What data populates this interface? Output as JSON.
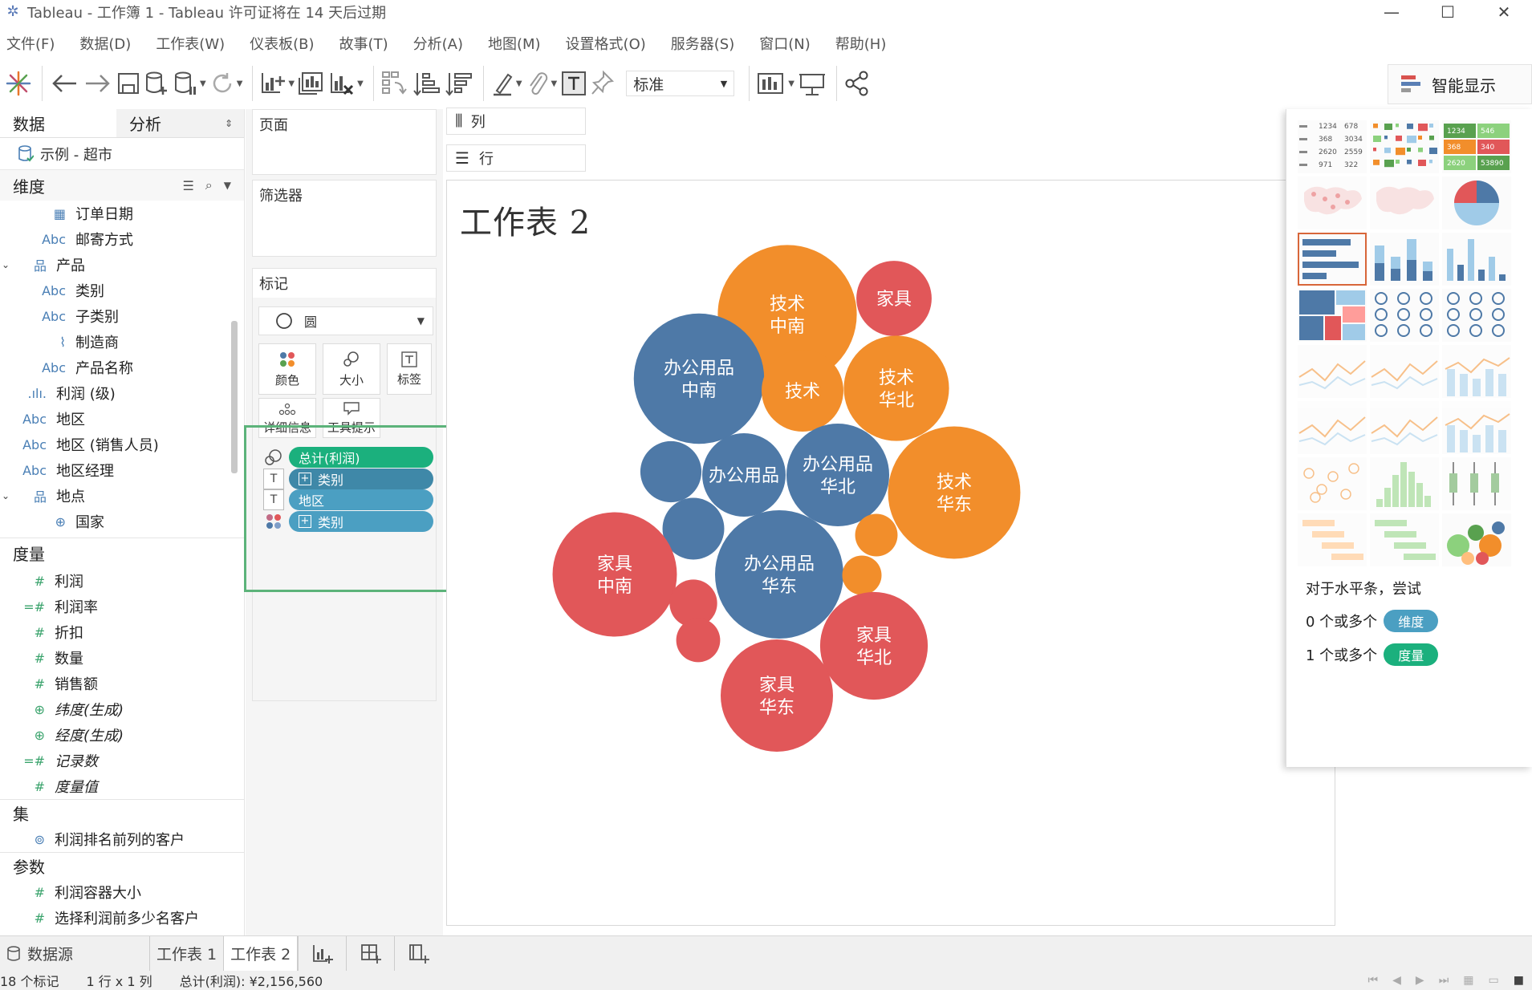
{
  "window": {
    "title": "Tableau - 工作簿 1 - Tableau 许可证将在 14 天后过期",
    "minimize": "—",
    "maximize": "☐",
    "close": "✕"
  },
  "menu": [
    "文件(F)",
    "数据(D)",
    "工作表(W)",
    "仪表板(B)",
    "故事(T)",
    "分析(A)",
    "地图(M)",
    "设置格式(O)",
    "服务器(S)",
    "窗口(N)",
    "帮助(H)"
  ],
  "toolbar": {
    "fit_select": "标准",
    "show_me_label": "智能显示"
  },
  "datapane": {
    "tab_data": "数据",
    "tab_analysis": "分析",
    "datasource": "示例 - 超市",
    "dimensions_label": "维度",
    "dimensions": [
      {
        "icon": "calendar-icon",
        "glyph": "▦",
        "label": "订单日期",
        "indent": 1,
        "caret": ""
      },
      {
        "icon": "abc-icon",
        "glyph": "Abc",
        "label": "邮寄方式",
        "indent": 1,
        "caret": ""
      },
      {
        "icon": "hierarchy-icon",
        "glyph": "品",
        "label": "产品",
        "indent": 0,
        "caret": "⌄"
      },
      {
        "icon": "abc-icon",
        "glyph": "Abc",
        "label": "类别",
        "indent": 1,
        "caret": ""
      },
      {
        "icon": "abc-icon",
        "glyph": "Abc",
        "label": "子类别",
        "indent": 1,
        "caret": ""
      },
      {
        "icon": "paperclip-icon",
        "glyph": "⌇",
        "label": "制造商",
        "indent": 1,
        "caret": ""
      },
      {
        "icon": "abc-icon",
        "glyph": "Abc",
        "label": "产品名称",
        "indent": 1,
        "caret": ""
      },
      {
        "icon": "bin-icon",
        "glyph": ".ılı.",
        "label": "利润 (级)",
        "indent": 0,
        "caret": ""
      },
      {
        "icon": "abc-icon",
        "glyph": "Abc",
        "label": "地区",
        "indent": 0,
        "caret": ""
      },
      {
        "icon": "abc-icon",
        "glyph": "Abc",
        "label": "地区 (销售人员)",
        "indent": 0,
        "caret": ""
      },
      {
        "icon": "abc-icon",
        "glyph": "Abc",
        "label": "地区经理",
        "indent": 0,
        "caret": ""
      },
      {
        "icon": "hierarchy-icon",
        "glyph": "品",
        "label": "地点",
        "indent": 0,
        "caret": "⌄"
      },
      {
        "icon": "globe-icon",
        "glyph": "⊕",
        "label": "国家",
        "indent": 1,
        "caret": ""
      }
    ],
    "measures_label": "度量",
    "measures": [
      {
        "glyph": "#",
        "label": "利润",
        "italic": false
      },
      {
        "glyph": "=#",
        "label": "利润率",
        "italic": false
      },
      {
        "glyph": "#",
        "label": "折扣",
        "italic": false
      },
      {
        "glyph": "#",
        "label": "数量",
        "italic": false
      },
      {
        "glyph": "#",
        "label": "销售额",
        "italic": false
      },
      {
        "glyph": "⊕",
        "label": "纬度(生成)",
        "italic": true
      },
      {
        "glyph": "⊕",
        "label": "经度(生成)",
        "italic": true
      },
      {
        "glyph": "=#",
        "label": "记录数",
        "italic": true
      },
      {
        "glyph": "#",
        "label": "度量值",
        "italic": true
      }
    ],
    "sets_label": "集",
    "sets": [
      {
        "label": "利润排名前列的客户"
      }
    ],
    "params_label": "参数",
    "params": [
      {
        "label": "利润容器大小"
      },
      {
        "label": "选择利润前多少名客户"
      }
    ]
  },
  "cards": {
    "pages": "页面",
    "filters": "筛选器",
    "marks": "标记",
    "mark_type": "圆",
    "btn_color": "颜色",
    "btn_size": "大小",
    "btn_label": "标签",
    "btn_detail": "详细信息",
    "btn_tooltip": "工具提示",
    "mark_pills": [
      {
        "type": "size-icon",
        "text": "总计(利润)",
        "color": "#1bb07d",
        "plus": false
      },
      {
        "type": "label-icon",
        "text": "类别",
        "color": "#3f88a8",
        "plus": true
      },
      {
        "type": "label-icon",
        "text": "地区",
        "color": "#4b9fc2",
        "plus": false
      },
      {
        "type": "color-icon",
        "text": "类别",
        "color": "#4b9fc2",
        "plus": true
      }
    ]
  },
  "shelves": {
    "columns": "列",
    "rows": "行"
  },
  "sheet": {
    "title": "工作表 2"
  },
  "chart_data": {
    "type": "bubble",
    "title": "工作表 2",
    "colors": {
      "办公用品": "#4e79a7",
      "技术": "#f28e2b",
      "家具": "#e15759"
    },
    "bubbles": [
      {
        "category": "技术",
        "region": "中南",
        "labels": [
          "技术",
          "中南"
        ],
        "size": 7500
      },
      {
        "category": "家具",
        "region": "",
        "labels": [
          "家具"
        ],
        "size": 2200
      },
      {
        "category": "办公用品",
        "region": "中南",
        "labels": [
          "办公用品",
          "中南"
        ],
        "size": 6600
      },
      {
        "category": "技术",
        "region": "",
        "labels": [
          "技术"
        ],
        "size": 2600
      },
      {
        "category": "技术",
        "region": "华北",
        "labels": [
          "技术",
          "华北"
        ],
        "size": 4300
      },
      {
        "category": "办公用品",
        "region": "",
        "labels": [],
        "size": 1450
      },
      {
        "category": "办公用品",
        "region": "",
        "labels": [
          "办公用品"
        ],
        "size": 2700
      },
      {
        "category": "办公用品",
        "region": "华北",
        "labels": [
          "办公用品",
          "华北"
        ],
        "size": 4100
      },
      {
        "category": "技术",
        "region": "华东",
        "labels": [
          "技术",
          "华东"
        ],
        "size": 6800
      },
      {
        "category": "办公用品",
        "region": "",
        "labels": [],
        "size": 1480
      },
      {
        "category": "技术",
        "region": "",
        "labels": [],
        "size": 700
      },
      {
        "category": "家具",
        "region": "中南",
        "labels": [
          "家具",
          "中南"
        ],
        "size": 6000
      },
      {
        "category": "家具",
        "region": "",
        "labels": [],
        "size": 880
      },
      {
        "category": "办公用品",
        "region": "华东",
        "labels": [
          "办公用品",
          "华东"
        ],
        "size": 6400
      },
      {
        "category": "技术",
        "region": "",
        "labels": [],
        "size": 600
      },
      {
        "category": "家具",
        "region": "华北",
        "labels": [
          "家具",
          "华北"
        ],
        "size": 4500
      },
      {
        "category": "家具",
        "region": "",
        "labels": [],
        "size": 750
      },
      {
        "category": "家具",
        "region": "华东",
        "labels": [
          "家具",
          "华东"
        ],
        "size": 4900
      }
    ]
  },
  "showme": {
    "hint_title": "对于水平条，尝试",
    "hint_dims": "0 个或多个",
    "hint_dims_pill": "维度",
    "hint_meas": "1 个或多个",
    "hint_meas_pill": "度量",
    "text_table_values": [
      "1234",
      "678",
      "368",
      "3034",
      "2620",
      "2559",
      "971",
      "322"
    ],
    "highlight_values": [
      "1234",
      "546",
      "368",
      "340",
      "2620",
      "53890"
    ]
  },
  "tabs": {
    "datasource": "数据源",
    "sheet1": "工作表 1",
    "sheet2": "工作表 2"
  },
  "status": {
    "marks": "18 个标记",
    "rows_cols": "1 行 x 1 列",
    "sum": "总计(利润): ¥2,156,560"
  }
}
